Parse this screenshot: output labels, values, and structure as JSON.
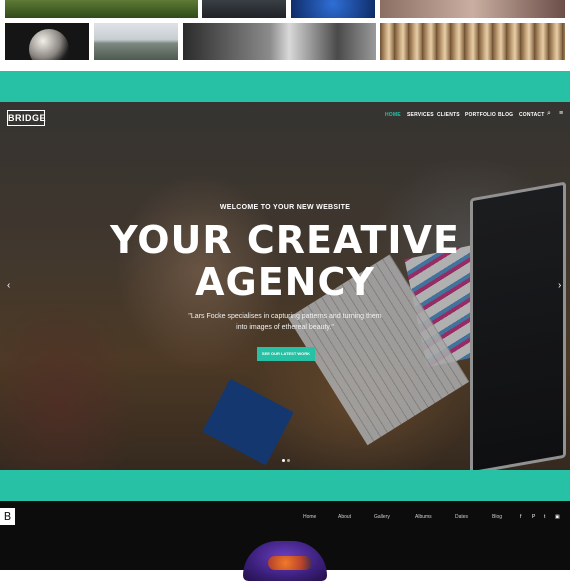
{
  "brand": {
    "teal": "#27c1a5"
  },
  "hero": {
    "logo": "BRIDGE",
    "nav": [
      "HOME",
      "SERVICES",
      "CLIENTS",
      "PORTFOLIO",
      "BLOG",
      "CONTACT"
    ],
    "active_nav": "HOME",
    "search_icon": "⌕",
    "menu_icon": "≡",
    "eyebrow": "WELCOME TO YOUR NEW WEBSITE",
    "title_line1": "YOUR CREATIVE",
    "title_line2": "AGENCY",
    "quote_line1": "\"Lars Focke specialises in capturing patterns and turning them",
    "quote_line2": "into images of ethereal beauty.\"",
    "cta": "SEE OUR LATEST WORK",
    "prev_arrow": "‹",
    "next_arrow": "›"
  },
  "bottom_site": {
    "logo": "B",
    "nav": [
      "Home",
      "About",
      "Gallery",
      "Albums",
      "Dates",
      "Blog"
    ],
    "social": [
      "f",
      "P",
      "t",
      "▣"
    ]
  }
}
